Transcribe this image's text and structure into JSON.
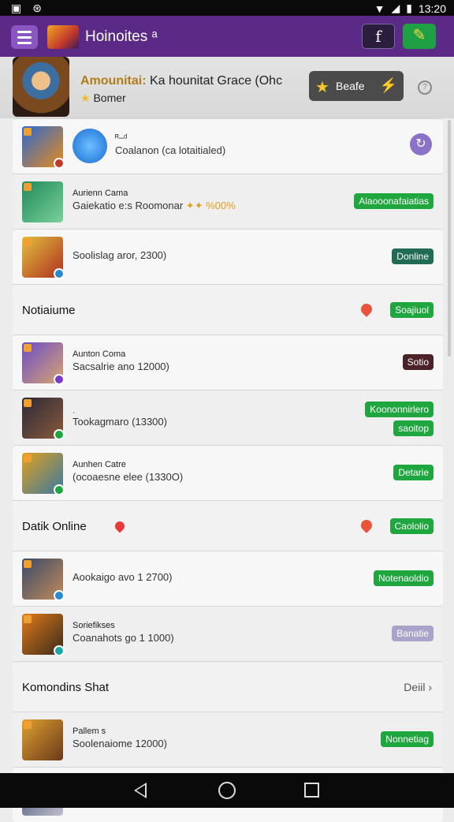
{
  "status": {
    "time": "13:20"
  },
  "appbar": {
    "title": "Hoinoites ᵃ",
    "btn1_label": "f"
  },
  "profile": {
    "name_gold": "Amounitai:",
    "name_rest": " Ka hounitat Grace (Ohc",
    "rank": "Bomer",
    "badge_label": "Beafe"
  },
  "rows": [
    {
      "type": "item",
      "title": "ᴿ–ᵈ",
      "subtitle": "Coalanon (ca lotaitialed)",
      "action": "icon",
      "thumb_colors": [
        "#2a6ad1",
        "#e88a1a"
      ],
      "dot": "#c0392b"
    },
    {
      "type": "item",
      "title": "Aurienn Cama",
      "subtitle": "Gaiekatio e:s Roomonar",
      "highlight": "✦✦ %00%",
      "button": "Alaooonafaiatias",
      "btn_color": "green",
      "thumb_colors": [
        "#1f8a5a",
        "#7ad09a"
      ]
    },
    {
      "type": "item",
      "subtitle": "Soolislag aror, 2300)",
      "button": "Donline",
      "btn_color": "teal",
      "thumb_colors": [
        "#e0c040",
        "#b0301e"
      ],
      "dot": "#2a8ad1"
    },
    {
      "type": "section",
      "title": "Notiaiume",
      "button": "Soajiuol",
      "pin": true
    },
    {
      "type": "item",
      "title": "Aunton Coma",
      "subtitle": "Sacsalrie ano 12000)",
      "button": "Sotio",
      "btn_color": "maroon",
      "thumb_colors": [
        "#6a4cc7",
        "#d8a470"
      ],
      "dot": "#7a3ac9"
    },
    {
      "type": "item",
      "title": "ˌ",
      "subtitle": "Tookagmaro (13300)",
      "button": "Koononnirlero",
      "button2": "saoitop",
      "btn_color": "green",
      "thumb_colors": [
        "#2a2a3a",
        "#8a5a3a"
      ],
      "dot": "#1fa63e"
    },
    {
      "type": "item",
      "title": "Aunhen Catre",
      "subtitle": "(ocoaesne elee (1330O)",
      "button": "Detarie",
      "btn_color": "green",
      "thumb_colors": [
        "#e0a020",
        "#3a7aa0"
      ],
      "dot": "#1fa63e"
    },
    {
      "type": "section",
      "title": "Datik Online",
      "button": "Caololio",
      "pin": true,
      "marker": true
    },
    {
      "type": "item",
      "subtitle": "Aookaigo avo 1 2700)",
      "button": "Notenaoldio",
      "btn_color": "green",
      "thumb_colors": [
        "#3a4a6a",
        "#c08a5a"
      ],
      "dot": "#2a8ad1"
    },
    {
      "type": "item",
      "title": "Soriefikses",
      "subtitle": "Coanahots go 1 1000)",
      "button": "Banatie",
      "btn_color": "lilac",
      "thumb_colors": [
        "#e07a1a",
        "#3a2a1a"
      ],
      "dot": "#1fa6a0"
    },
    {
      "type": "section",
      "title": "Komondins Shat",
      "more": "Deiil ›"
    },
    {
      "type": "item",
      "title": "Pallem s",
      "subtitle": "Soolenaiome 12000)",
      "button": "Nonnetiag",
      "btn_color": "green",
      "thumb_colors": [
        "#e0a030",
        "#6a3a1a"
      ]
    },
    {
      "type": "item",
      "title": "",
      "subtitle": "",
      "button": "",
      "btn_color": "green",
      "thumb_colors": [
        "#3a4a6a",
        "#c0c0d0"
      ]
    }
  ]
}
